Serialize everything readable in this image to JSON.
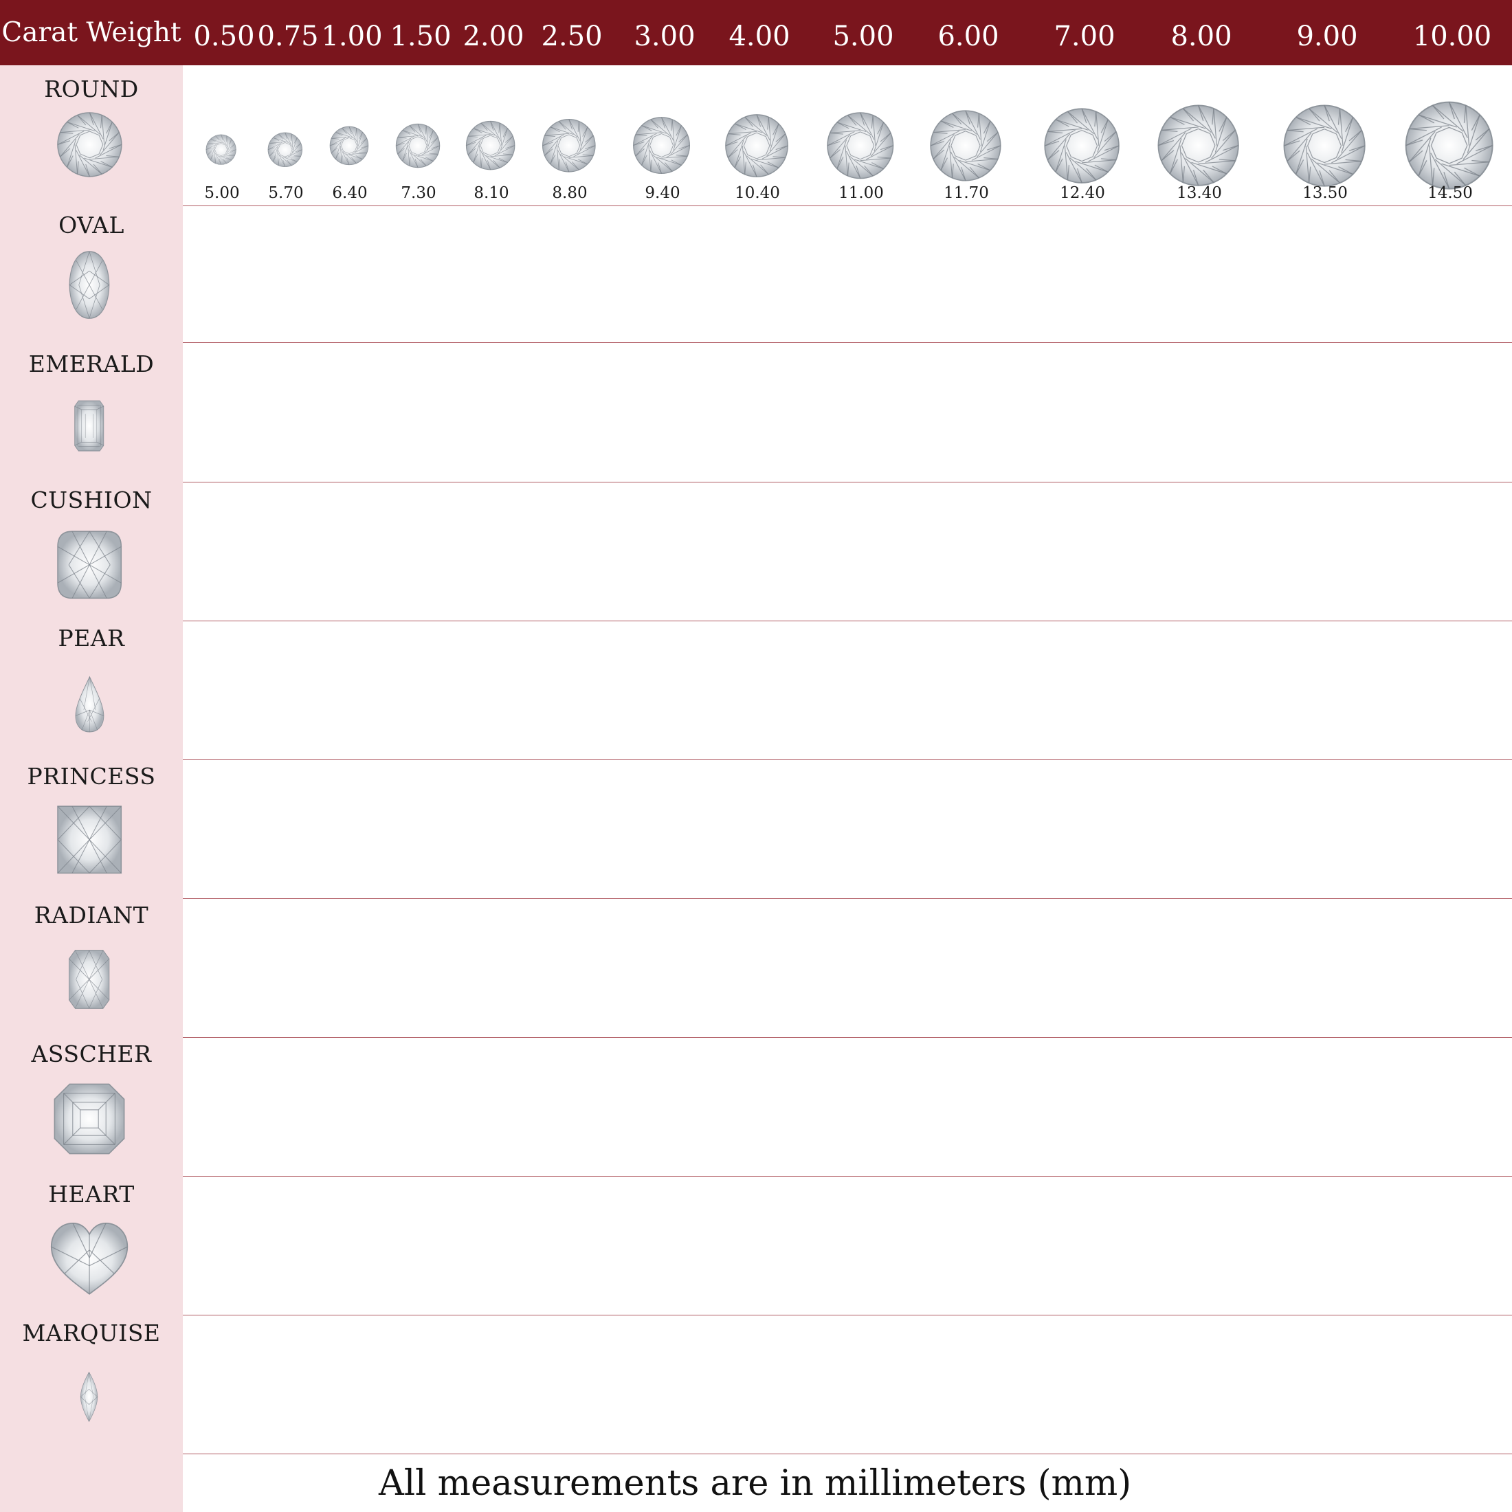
{
  "header": {
    "title": "Carat Weight",
    "background_color": "#7a151d"
  },
  "sidebar": {
    "background_color": "#f5dfe2"
  },
  "carat_weights": [
    "0.50",
    "0.75",
    "1.00",
    "1.50",
    "2.00",
    "2.50",
    "3.00",
    "4.00",
    "5.00",
    "6.00",
    "7.00",
    "8.00",
    "9.00",
    "10.00"
  ],
  "round_diameters_mm": [
    "5.00",
    "5.70",
    "6.40",
    "7.30",
    "8.10",
    "8.80",
    "9.40",
    "10.40",
    "11.00",
    "11.70",
    "12.40",
    "13.40",
    "13.50",
    "14.50"
  ],
  "shapes": [
    {
      "label": "ROUND",
      "icon": "round-diamond-icon"
    },
    {
      "label": "OVAL",
      "icon": "oval-diamond-icon"
    },
    {
      "label": "EMERALD",
      "icon": "emerald-diamond-icon"
    },
    {
      "label": "CUSHION",
      "icon": "cushion-diamond-icon"
    },
    {
      "label": "PEAR",
      "icon": "pear-diamond-icon"
    },
    {
      "label": "PRINCESS",
      "icon": "princess-diamond-icon"
    },
    {
      "label": "RADIANT",
      "icon": "radiant-diamond-icon"
    },
    {
      "label": "ASSCHER",
      "icon": "asscher-diamond-icon"
    },
    {
      "label": "HEART",
      "icon": "heart-diamond-icon"
    },
    {
      "label": "MARQUISE",
      "icon": "marquise-diamond-icon"
    }
  ],
  "footer": {
    "note": "All measurements are in millimeters (mm)"
  }
}
